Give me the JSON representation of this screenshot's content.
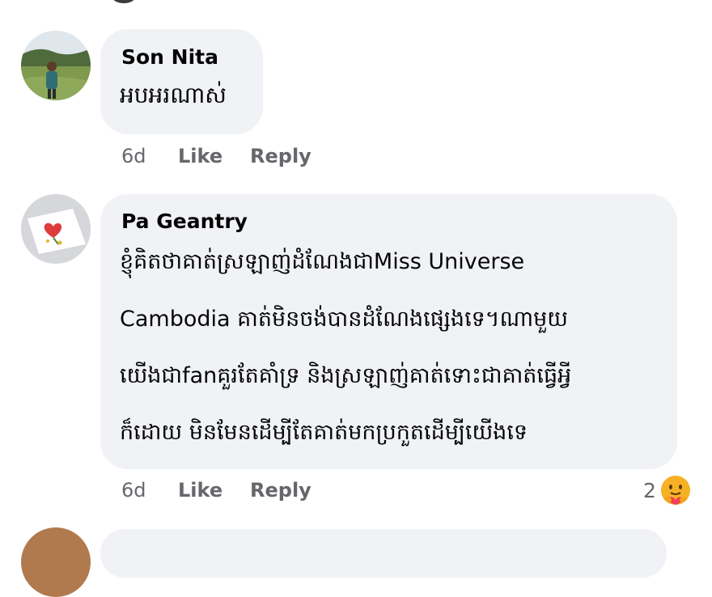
{
  "comments": [
    {
      "author": "Son Nita",
      "lines": [
        "អបអរណាស់"
      ],
      "time": "6d",
      "like_label": "Like",
      "reply_label": "Reply"
    },
    {
      "author": "Pa Geantry",
      "lines": [
        "ខ្ញុំគិតថាគាត់ស្រឡាញ់ដំណែងជាMiss Universe",
        "Cambodia គាត់មិនចង់បានដំណែងផ្សេងទេ។ណាមួយ",
        "យើងជាfanគួរតែគាំទ្រ និងស្រឡាញ់គាត់ទោះជាគាត់ធ្វើអ្វី",
        "ក៏ដោយ មិនមែនដើម្បីតែគាត់មកប្រកួតដើម្បីយើងទេ"
      ],
      "time": "6d",
      "like_label": "Like",
      "reply_label": "Reply",
      "reaction_count": "2",
      "reaction_icon": "care-emoji-icon"
    }
  ],
  "colors": {
    "bubble": "#f0f2f5",
    "meta_text": "#65676b",
    "author_text": "#050505"
  }
}
